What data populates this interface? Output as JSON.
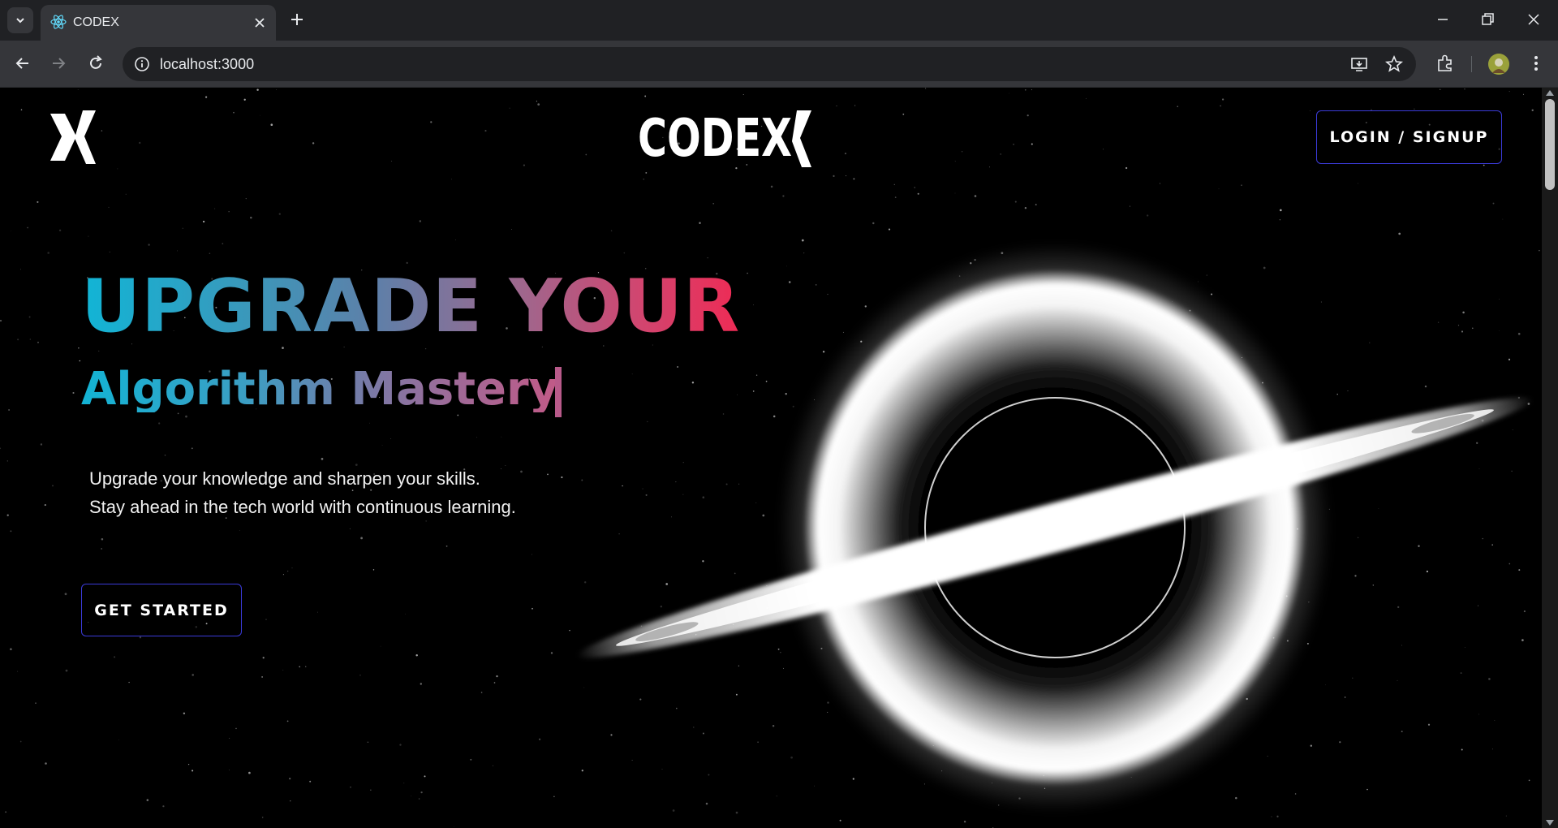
{
  "browser": {
    "tab_title": "CODEX",
    "url": "localhost:3000"
  },
  "site": {
    "brand": "CODEX",
    "login_label": "LOGIN / SIGNUP"
  },
  "hero": {
    "title": "UPGRADE YOUR",
    "subtitle": "Algorithm Mastery",
    "description_line1": "Upgrade your knowledge and sharpen your skills.",
    "description_line2": "Stay ahead in the tech world with continuous learning.",
    "cta_label": "GET STARTED"
  },
  "colors": {
    "accent_border": "#3b3bd9",
    "gradient_start": "#11b5d6",
    "gradient_end": "#ee2b55"
  }
}
